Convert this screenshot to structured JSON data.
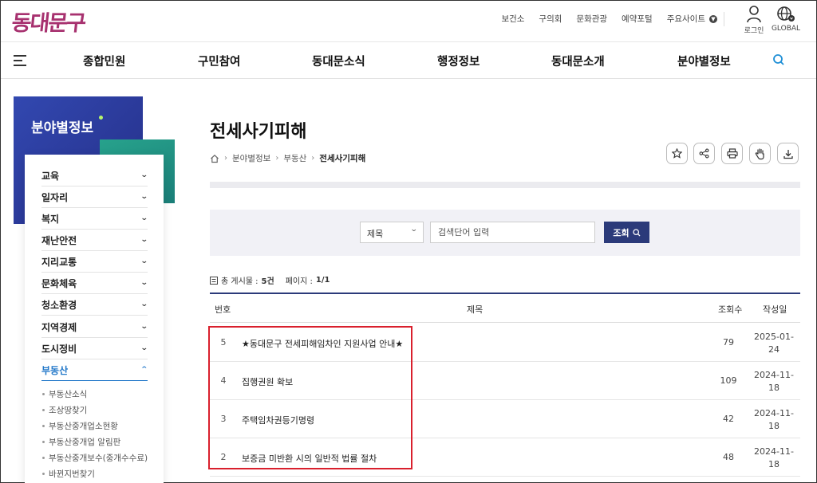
{
  "header": {
    "logo": "동대문구",
    "utils": [
      "보건소",
      "구의회",
      "문화관광",
      "예약포털"
    ],
    "utils_more": "주요사이트",
    "login": "로그인",
    "global": "GLOBAL"
  },
  "gnb": [
    "종합민원",
    "구민참여",
    "동대문소식",
    "행정정보",
    "동대문소개",
    "분야별정보"
  ],
  "lnb": {
    "title": "분야별정보",
    "items": [
      "교육",
      "일자리",
      "복지",
      "재난안전",
      "지리교통",
      "문화체육",
      "청소환경",
      "지역경제",
      "도시정비",
      "부동산"
    ],
    "active_index": 9,
    "subitems": [
      "부동산소식",
      "조상땅찾기",
      "부동산중개업소현황",
      "부동산중개업 알림판",
      "부동산중개보수(중개수수료)",
      "바뀐지번찾기"
    ]
  },
  "page": {
    "title": "전세사기피해",
    "breadcrumb": [
      "분야별정보",
      "부동산",
      "전세사기피해"
    ]
  },
  "tools": [
    "star-icon",
    "share-icon",
    "print-icon",
    "hand-icon",
    "download-icon"
  ],
  "search": {
    "select_value": "제목",
    "placeholder": "검색단어 입력",
    "button": "조회"
  },
  "count": {
    "total_label": "총 게시물 :",
    "total_value": "5건",
    "page_label": "페이지 :",
    "page_value": "1/1"
  },
  "table": {
    "headers": [
      "번호",
      "제목",
      "조회수",
      "작성일"
    ],
    "rows": [
      {
        "no": "5",
        "title": "★동대문구 전세피해임차인 지원사업 안내★",
        "views": "79",
        "date1": "2025-01-",
        "date2": "24"
      },
      {
        "no": "4",
        "title": "집행권원 확보",
        "views": "109",
        "date1": "2024-11-",
        "date2": "18"
      },
      {
        "no": "3",
        "title": "주택임차권등기명령",
        "views": "42",
        "date1": "2024-11-",
        "date2": "18"
      },
      {
        "no": "2",
        "title": "보증금 미반환 시의 일반적 법률 절차",
        "views": "48",
        "date1": "2024-11-",
        "date2": "18"
      }
    ]
  },
  "colors": {
    "brand": "#a7316f",
    "navy": "#2b3a7a",
    "active": "#1f76c8",
    "highlight": "#d9202d"
  }
}
